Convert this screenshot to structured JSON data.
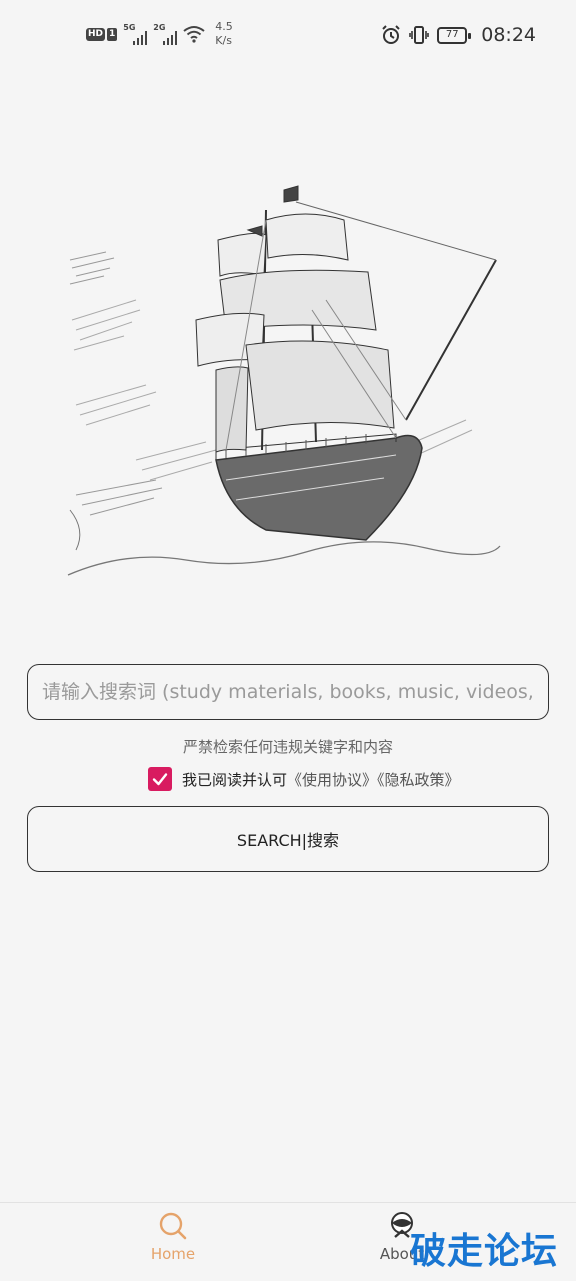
{
  "status_bar": {
    "hd": "HD",
    "sim": "1",
    "net1": "5G",
    "net2": "2G",
    "speed_value": "4.5",
    "speed_unit": "K/s",
    "battery": "77",
    "time": "08:24"
  },
  "search": {
    "placeholder": "请输入搜索词 (study materials, books, music, videos, software...)"
  },
  "warning": "严禁检索任何违规关键字和内容",
  "agreement": {
    "checked": true,
    "text": "我已阅读并认可",
    "terms_link": "《使用协议》",
    "privacy_link": "《隐私政策》"
  },
  "search_button": "SEARCH|搜索",
  "nav": {
    "home_label": "Home",
    "about_label": "About"
  },
  "watermark": "破走论坛",
  "colors": {
    "accent_checkbox": "#d81b60",
    "nav_active": "#e5a36a",
    "watermark": "#1976d2"
  }
}
